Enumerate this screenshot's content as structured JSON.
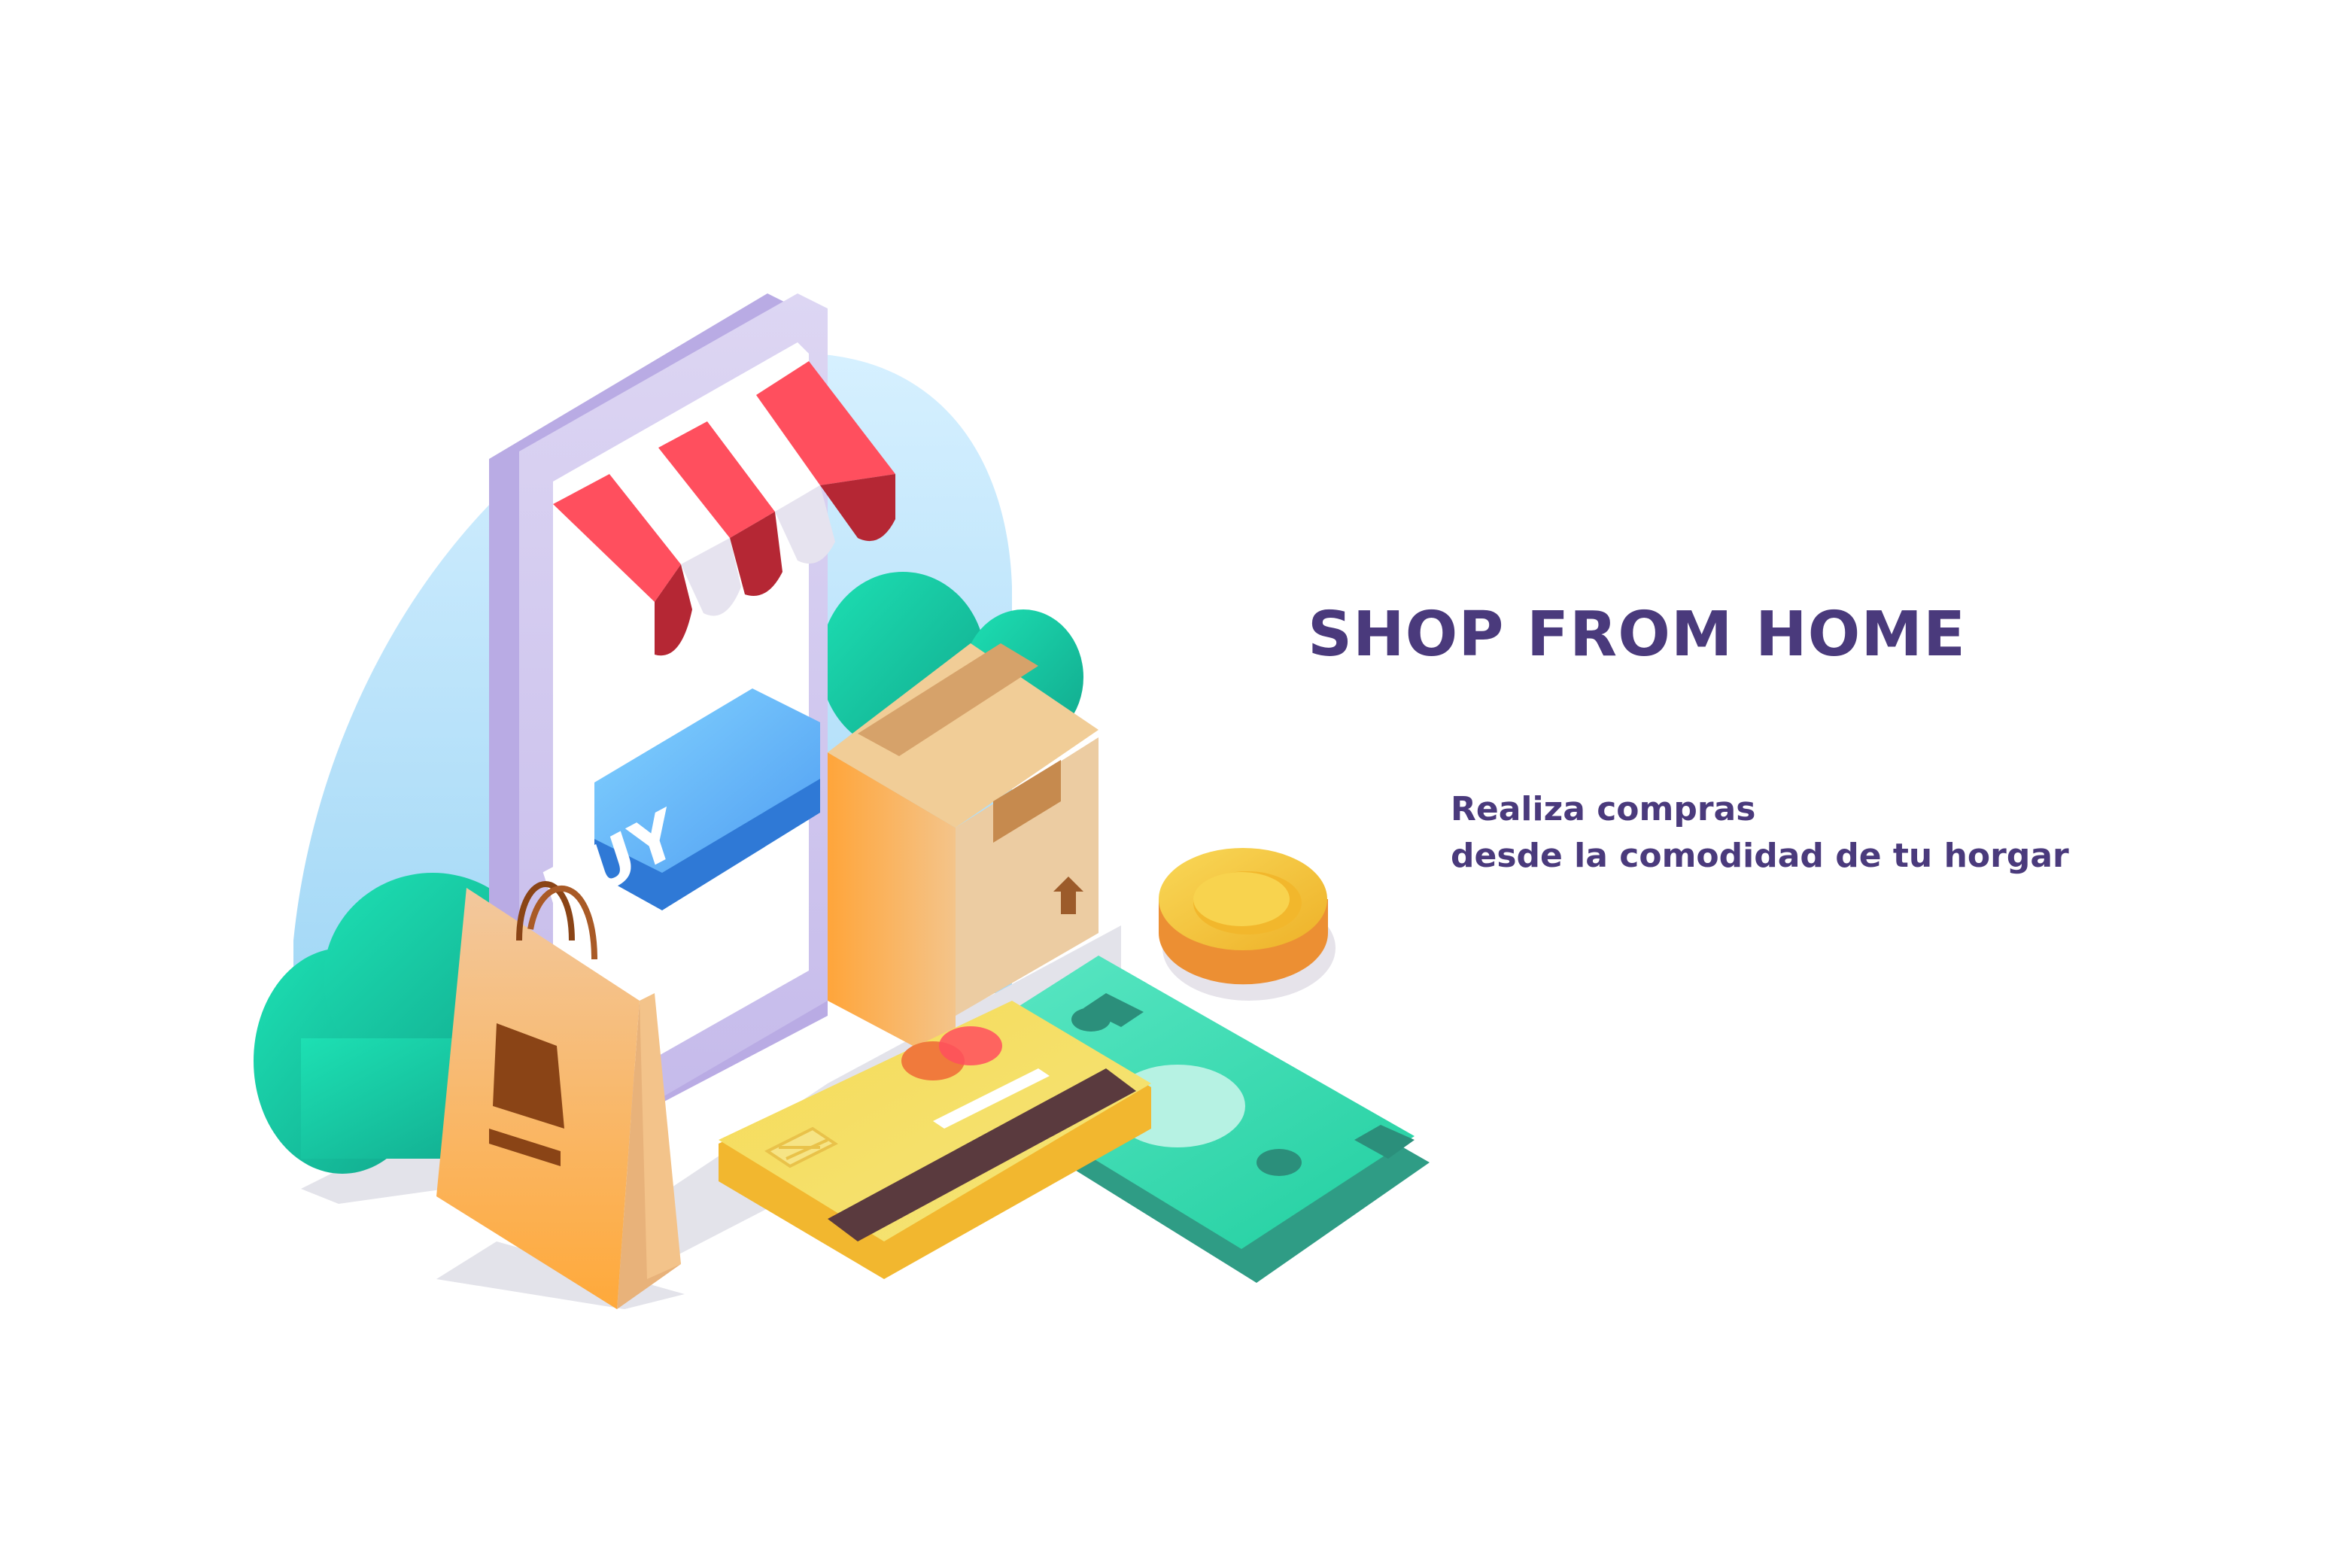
{
  "headline": "SHOP FROM HOME",
  "subtitle": {
    "line1": "Realiza compras",
    "line2": "desde la comodidad de tu horgar"
  },
  "phone_button_label": "BUY",
  "colors": {
    "text_purple": "#4a3a7c",
    "awning_red": "#ff4f5e",
    "buy_blue": "#4aa8f5",
    "leaf_green": "#18d4a6",
    "card_yellow": "#f7d84a",
    "cash_green": "#3bdcaf",
    "box_tan": "#e9c89b",
    "bag_orange": "#f6b865",
    "coin_gold": "#f3c23a",
    "backdrop_blue": "#bfe6fb"
  },
  "icons": [
    "smartphone-storefront-icon",
    "shopping-bag-icon",
    "cardboard-box-icon",
    "credit-card-icon",
    "banknotes-icon",
    "coin-icon"
  ]
}
